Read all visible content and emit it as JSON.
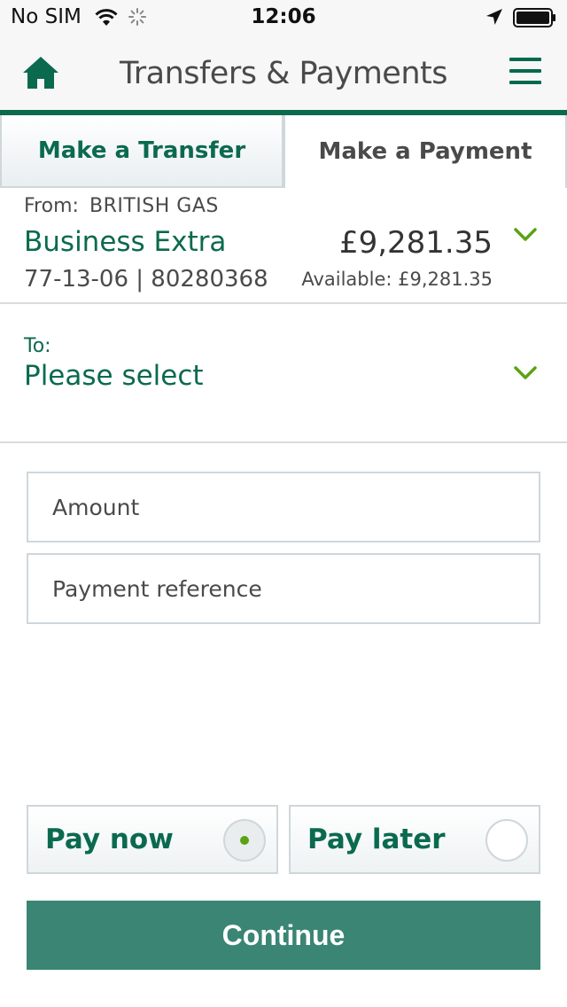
{
  "status_bar": {
    "carrier": "No SIM",
    "time": "12:06"
  },
  "header": {
    "title": "Transfers & Payments"
  },
  "tabs": [
    {
      "label": "Make a Transfer",
      "active": true
    },
    {
      "label": "Make a Payment",
      "active": false
    }
  ],
  "from": {
    "label": "From:",
    "name": "BRITISH GAS",
    "account_name": "Business Extra",
    "account_number": "77-13-06 | 80280368",
    "balance": "£9,281.35",
    "available": "Available:  £9,281.35"
  },
  "to": {
    "label": "To:",
    "value": "Please select"
  },
  "fields": {
    "amount_placeholder": "Amount",
    "reference_placeholder": "Payment reference"
  },
  "options": {
    "pay_now": "Pay now",
    "pay_later": "Pay later",
    "selected": "pay_now"
  },
  "continue_label": "Continue",
  "colors": {
    "brand_green": "#0b6a4e",
    "accent_green": "#5aa314",
    "button_green": "#3a8573"
  }
}
